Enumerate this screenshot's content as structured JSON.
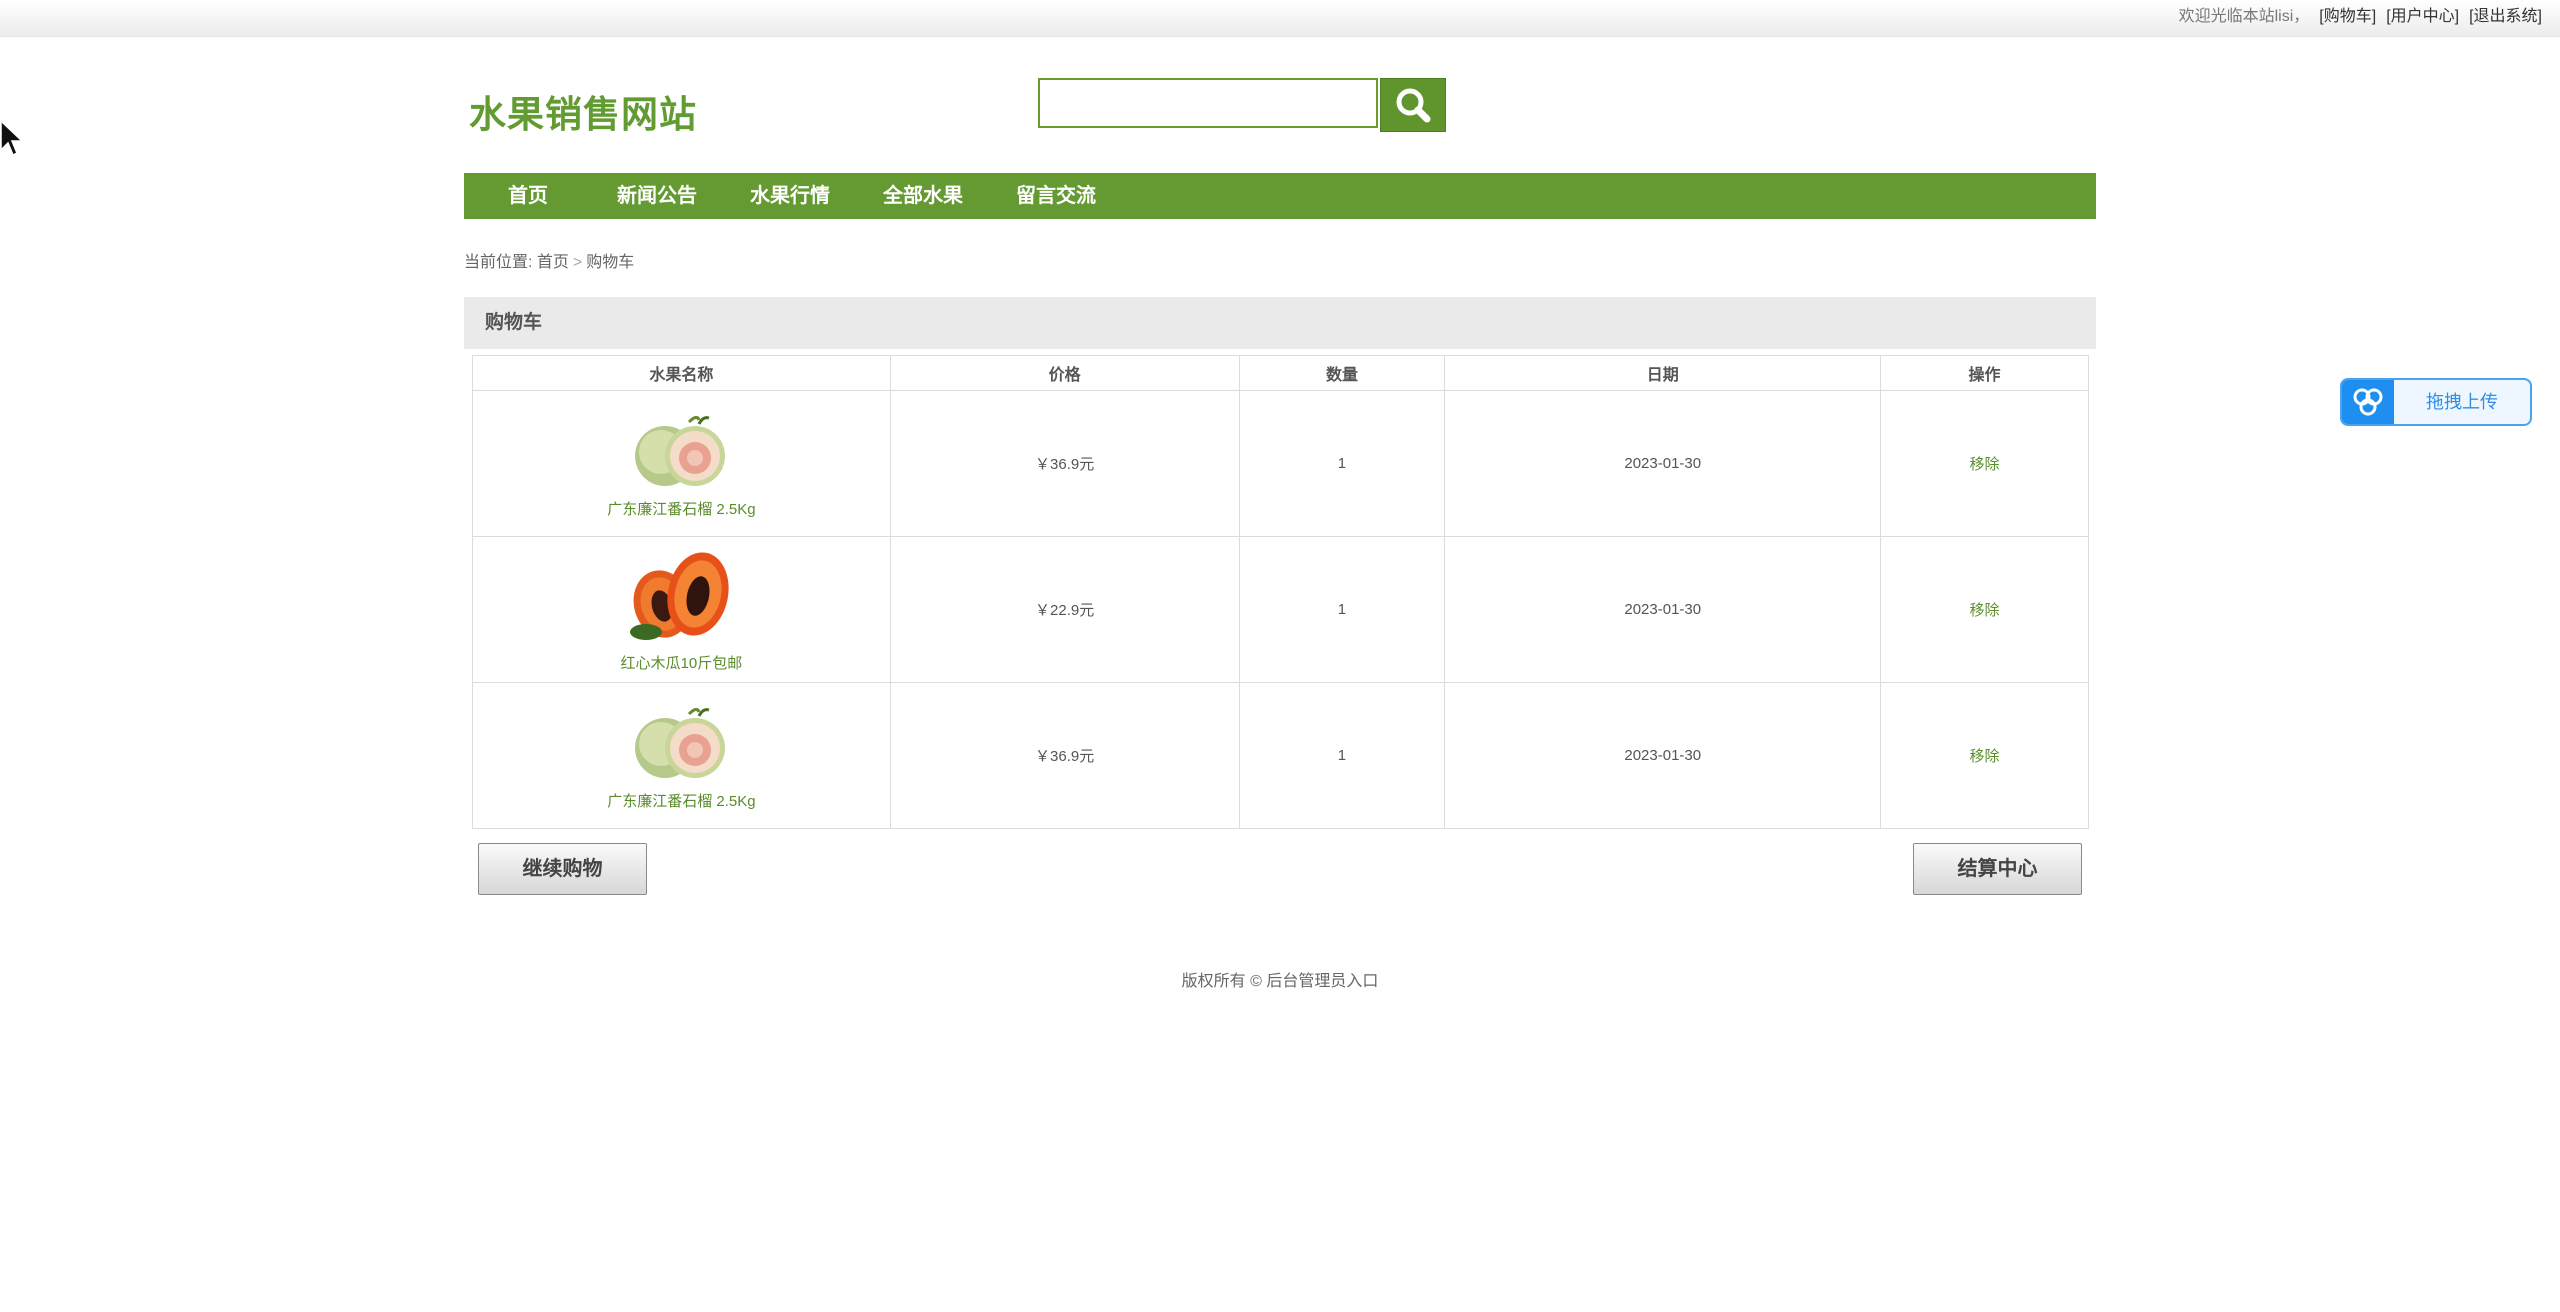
{
  "topbar": {
    "welcome": "欢迎光临本站lisi，",
    "links": [
      "[购物车]",
      "[用户中心]",
      "[退出系统]"
    ]
  },
  "site": {
    "title": "水果销售网站"
  },
  "search": {
    "placeholder": ""
  },
  "nav": [
    "首页",
    "新闻公告",
    "水果行情",
    "全部水果",
    "留言交流"
  ],
  "breadcrumb": {
    "prefix": "当前位置:",
    "home": "首页",
    "arrow": ">",
    "current": "购物车"
  },
  "cart": {
    "heading": "购物车",
    "columns": [
      "水果名称",
      "价格",
      "数量",
      "日期",
      "操作"
    ],
    "rows": [
      {
        "name": "广东廉江番石榴 2.5Kg",
        "price": "￥36.9元",
        "qty": "1",
        "date": "2023-01-30",
        "action": "移除",
        "image": "guava"
      },
      {
        "name": "红心木瓜10斤包邮",
        "price": "￥22.9元",
        "qty": "1",
        "date": "2023-01-30",
        "action": "移除",
        "image": "papaya"
      },
      {
        "name": "广东廉江番石榴 2.5Kg",
        "price": "￥36.9元",
        "qty": "1",
        "date": "2023-01-30",
        "action": "移除",
        "image": "guava"
      }
    ],
    "continue_label": "继续购物",
    "checkout_label": "结算中心"
  },
  "footer": {
    "copyright": "版权所有 © ",
    "admin_link": "后台管理员入口"
  },
  "upload_widget": {
    "label": "拖拽上传"
  },
  "colors": {
    "brand_green": "#659a33",
    "link_green": "#5a8c2b",
    "upload_blue": "#1e8ff0"
  }
}
